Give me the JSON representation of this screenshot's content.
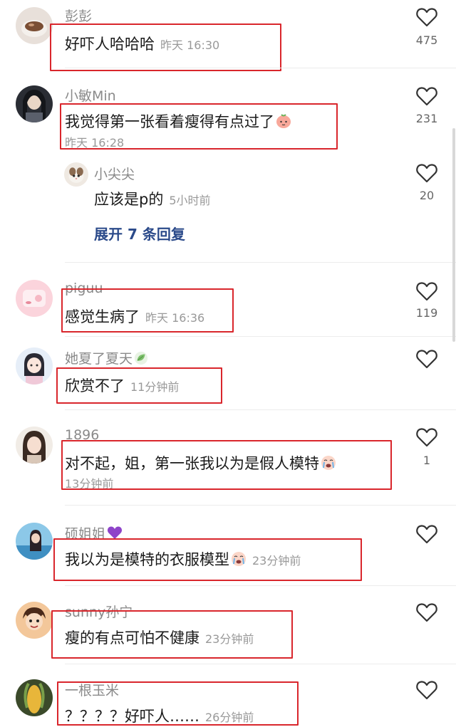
{
  "colors": {
    "accent_blue": "#2b4a8a",
    "highlight_red": "#d9262c",
    "muted": "#999999"
  },
  "comments": [
    {
      "user": "彭彭",
      "text": "好吓人哈哈哈",
      "time": "昨天 16:30",
      "likes": "475"
    },
    {
      "user": "小敏Min",
      "text": "我觉得第一张看着瘦得有点过了",
      "emoji": "peach-face-emoji",
      "time": "昨天 16:28",
      "likes": "231",
      "reply": {
        "user": "小尖尖",
        "text": "应该是p的",
        "time": "5小时前",
        "likes": "20"
      },
      "expand_label": "展开 7 条回复"
    },
    {
      "user": "piguu",
      "text": "感觉生病了",
      "time": "昨天 16:36",
      "likes": "119"
    },
    {
      "user": "她夏了夏天",
      "user_icon": "leaf-icon",
      "text": "欣赏不了",
      "time": "11分钟前",
      "likes": ""
    },
    {
      "user": "1896",
      "text": "对不起，姐，第一张我以为是假人模特",
      "emoji": "crying-face-emoji",
      "time": "13分钟前",
      "likes": "1"
    },
    {
      "user": "硕姐姐",
      "user_icon": "purple-heart-icon",
      "text": "我以为是模特的衣服模型",
      "emoji": "crying-face-emoji",
      "time": "23分钟前",
      "likes": ""
    },
    {
      "user": "sunny孙宁",
      "text": "瘦的有点可怕不健康",
      "time": "23分钟前",
      "likes": ""
    },
    {
      "user": "一根玉米",
      "text": "？？？？好吓人……",
      "time": "26分钟前",
      "likes": ""
    }
  ]
}
